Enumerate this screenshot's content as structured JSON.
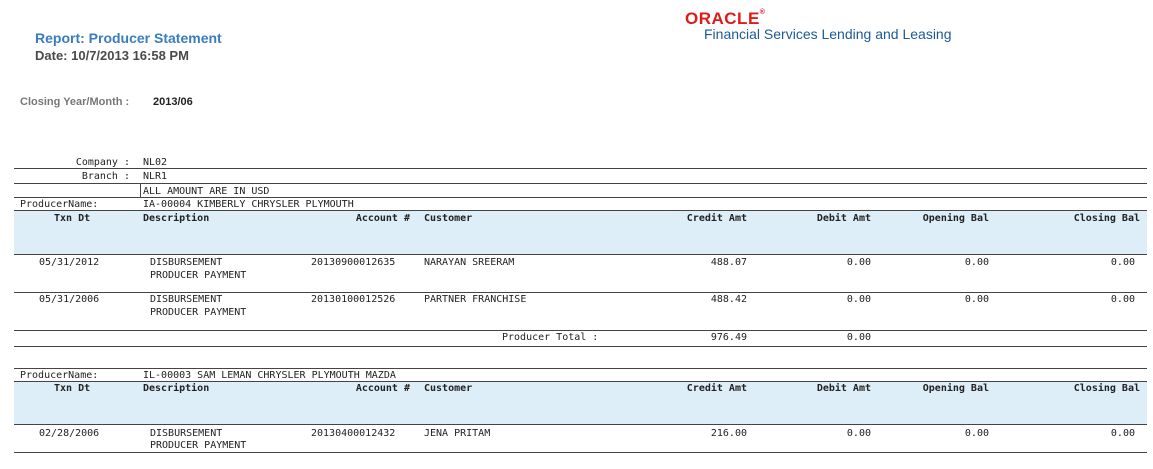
{
  "header": {
    "report_title": "Report: Producer Statement",
    "report_date": "Date: 10/7/2013  16:58 PM",
    "brand_name": "ORACLE",
    "brand_trademark": "®",
    "brand_subtitle": "Financial Services Lending and Leasing",
    "closing_label": "Closing Year/Month :",
    "closing_value": "2013/06"
  },
  "meta": {
    "company_label": "Company :",
    "company_value": "NL02",
    "branch_label": "Branch :",
    "branch_value": "NLR1",
    "currency_note": "ALL AMOUNT ARE IN USD"
  },
  "columns": [
    "Txn Dt",
    "Description",
    "Account #",
    "Customer",
    "Credit Amt",
    "Debit Amt",
    "Opening Bal",
    "Closing Bal"
  ],
  "producers": [
    {
      "label": "ProducerName:",
      "name": "IA-00004 KIMBERLY CHRYSLER PLYMOUTH",
      "rows": [
        {
          "date": "05/31/2012",
          "desc1": "DISBURSEMENT",
          "desc2": "PRODUCER PAYMENT",
          "account": "20130900012635",
          "customer": "NARAYAN SREERAM",
          "credit": "488.07",
          "debit": "0.00",
          "opening": "0.00",
          "closing": "0.00"
        },
        {
          "date": "05/31/2006",
          "desc1": "DISBURSEMENT",
          "desc2": "PRODUCER PAYMENT",
          "account": "20130100012526",
          "customer": "PARTNER FRANCHISE",
          "credit": "488.42",
          "debit": "0.00",
          "opening": "0.00",
          "closing": "0.00"
        }
      ],
      "total_label": "Producer Total :",
      "total_credit": "976.49",
      "total_debit": "0.00"
    },
    {
      "label": "ProducerName:",
      "name": "IL-00003 SAM LEMAN CHRYSLER PLYMOUTH MAZDA",
      "rows": [
        {
          "date": "02/28/2006",
          "desc1": "DISBURSEMENT",
          "desc2": "PRODUCER PAYMENT",
          "account": "20130400012432",
          "customer": "JENA PRITAM",
          "credit": "216.00",
          "debit": "0.00",
          "opening": "0.00",
          "closing": "0.00"
        }
      ]
    }
  ]
}
